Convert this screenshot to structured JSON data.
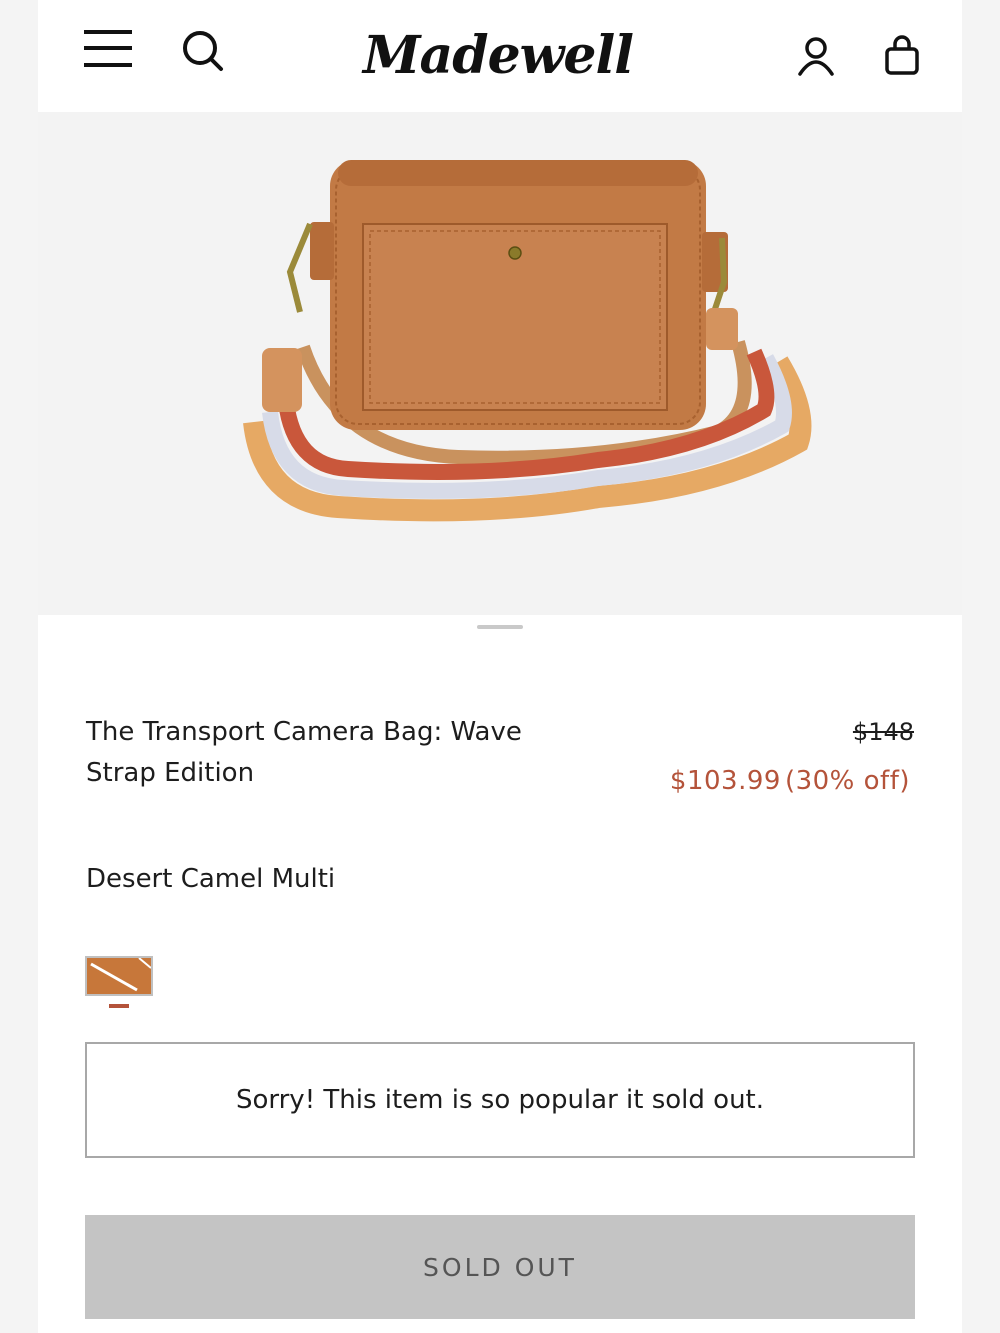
{
  "header": {
    "brand": "Madewell",
    "icons": [
      "menu-icon",
      "search-icon",
      "account-icon",
      "shopping-bag-icon"
    ]
  },
  "product": {
    "title": "The Transport Camera Bag: Wave Strap Edition",
    "price_original": "$148",
    "price_sale": "$103.99",
    "discount": "(30% off)",
    "color_name": "Desert Camel Multi",
    "swatch_color": "#c7773a",
    "notice": "Sorry! This item is so popular it sold out.",
    "button_label": "SOLD OUT"
  },
  "colors": {
    "sale": "#b4533a",
    "button_bg": "#c4c4c4",
    "bag_leather": "#c27a45"
  }
}
